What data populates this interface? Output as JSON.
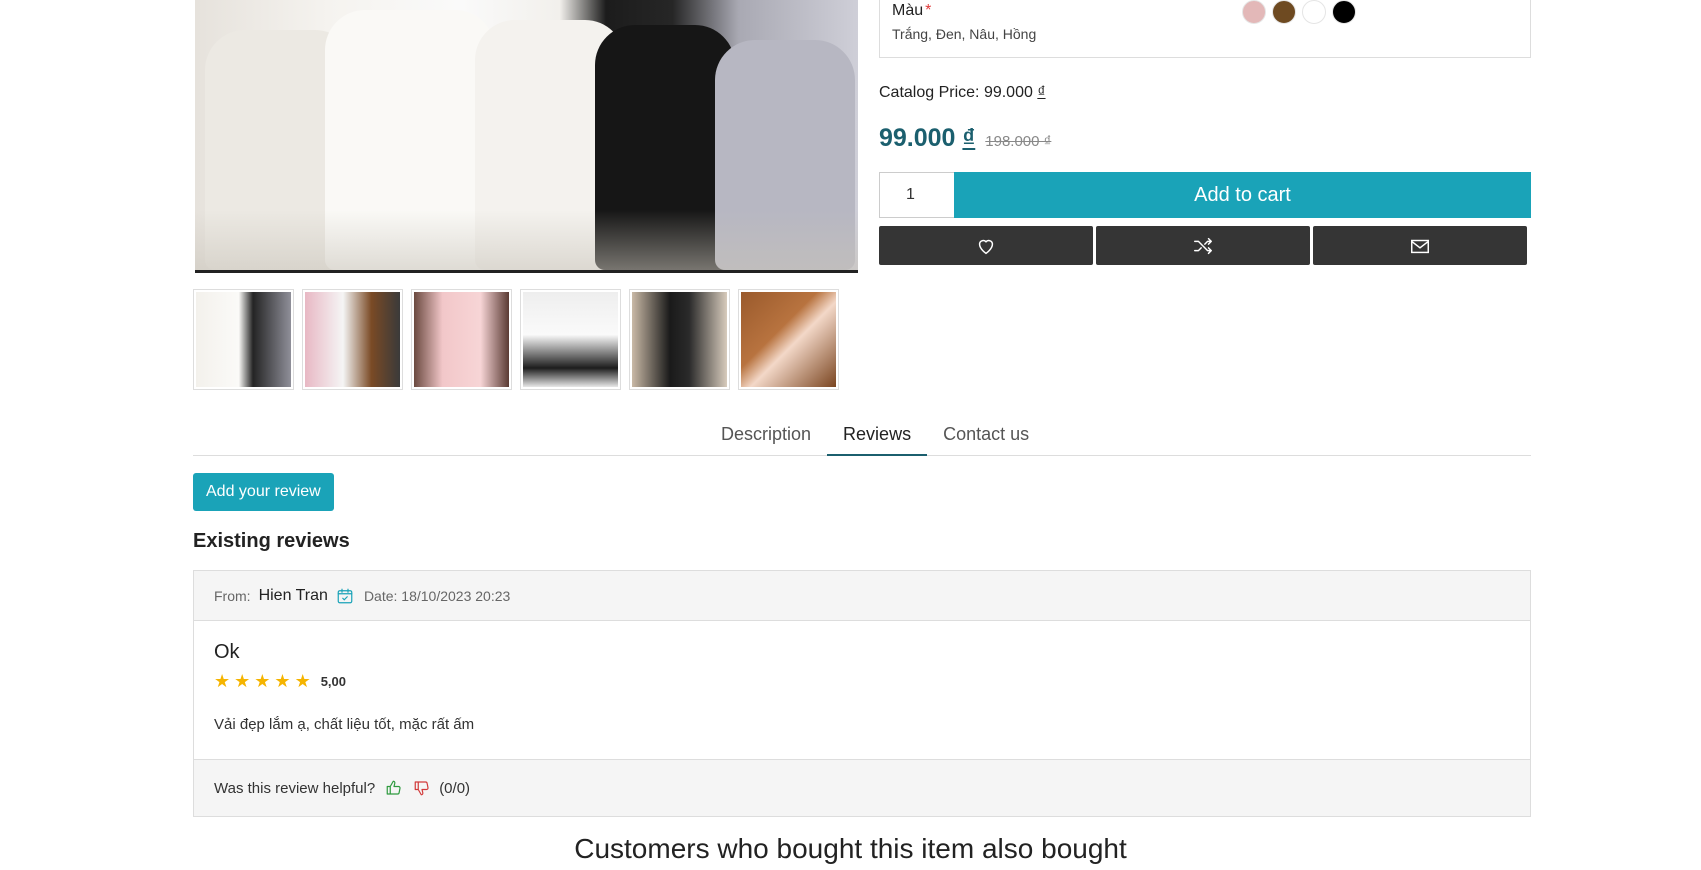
{
  "product": {
    "attribute": {
      "label": "Màu",
      "required_mark": "*",
      "values_text": "Trắng, Đen, Nâu, Hồng",
      "swatches": [
        {
          "name": "Hồng",
          "color": "#e3b8b8"
        },
        {
          "name": "Nâu",
          "color": "#6e4a21"
        },
        {
          "name": "Trắng",
          "color": "#ffffff"
        },
        {
          "name": "Đen",
          "color": "#000000"
        }
      ]
    },
    "catalog_price_label": "Catalog Price: 99.000",
    "catalog_price_currency": "₫",
    "price": "99.000",
    "price_currency": "₫",
    "old_price": "198.000 ₫",
    "quantity": "1",
    "add_to_cart_label": "Add to cart",
    "actions": [
      "heart-icon",
      "shuffle-icon",
      "envelope-icon"
    ]
  },
  "thumbnails": [
    {
      "alt": "white-black fur coats",
      "bg": "linear-gradient(90deg,#f3f1ec 0%,#fbfaf8 45%,#242424 60%,#8f8f99 100%)"
    },
    {
      "alt": "pink white brown coats",
      "bg": "linear-gradient(90deg,#e8b8c4 0%,#f5f5f5 40%,#7a4a25 70%,#3a3a3a 100%)"
    },
    {
      "alt": "two girls pink coats",
      "bg": "linear-gradient(90deg,#6b4a40 0%,#f2c7c9 30%,#f7d5d6 70%,#5a3a33 100%)"
    },
    {
      "alt": "girl white coat",
      "bg": "linear-gradient(180deg,#eeeeee 0%,#fafafa 45%,#1d1d1d 80%,#e8e8e8 100%)"
    },
    {
      "alt": "girl black coat",
      "bg": "linear-gradient(90deg,#c9b9a6 0%,#1a1a1a 40%,#2a2a2a 60%,#d7cbbc 100%)"
    },
    {
      "alt": "girl brown coat",
      "bg": "linear-gradient(135deg,#9a5a2c 0%,#b8733f 40%,#f3d8c8 55%,#7a4520 100%)"
    }
  ],
  "tabs": [
    {
      "label": "Description",
      "active": false
    },
    {
      "label": "Reviews",
      "active": true
    },
    {
      "label": "Contact us",
      "active": false
    }
  ],
  "add_review_label": "Add your review",
  "existing_reviews_title": "Existing reviews",
  "review": {
    "from_label": "From:",
    "author": "Hien Tran",
    "date_label": "Date: 18/10/2023 20:23",
    "title": "Ok",
    "stars": 5,
    "rating_value": "5,00",
    "text": "Vải đẹp lắm ạ, chất liệu tốt, mặc rất ấm",
    "helpful_label": "Was this review helpful?",
    "helpful_count": "(0/0)"
  },
  "also_bought_title": "Customers who bought this item also bought",
  "colors": {
    "accent": "#1aa3b8",
    "price": "#1b5f6e",
    "dark_button": "#353535",
    "star": "#f5b400"
  }
}
